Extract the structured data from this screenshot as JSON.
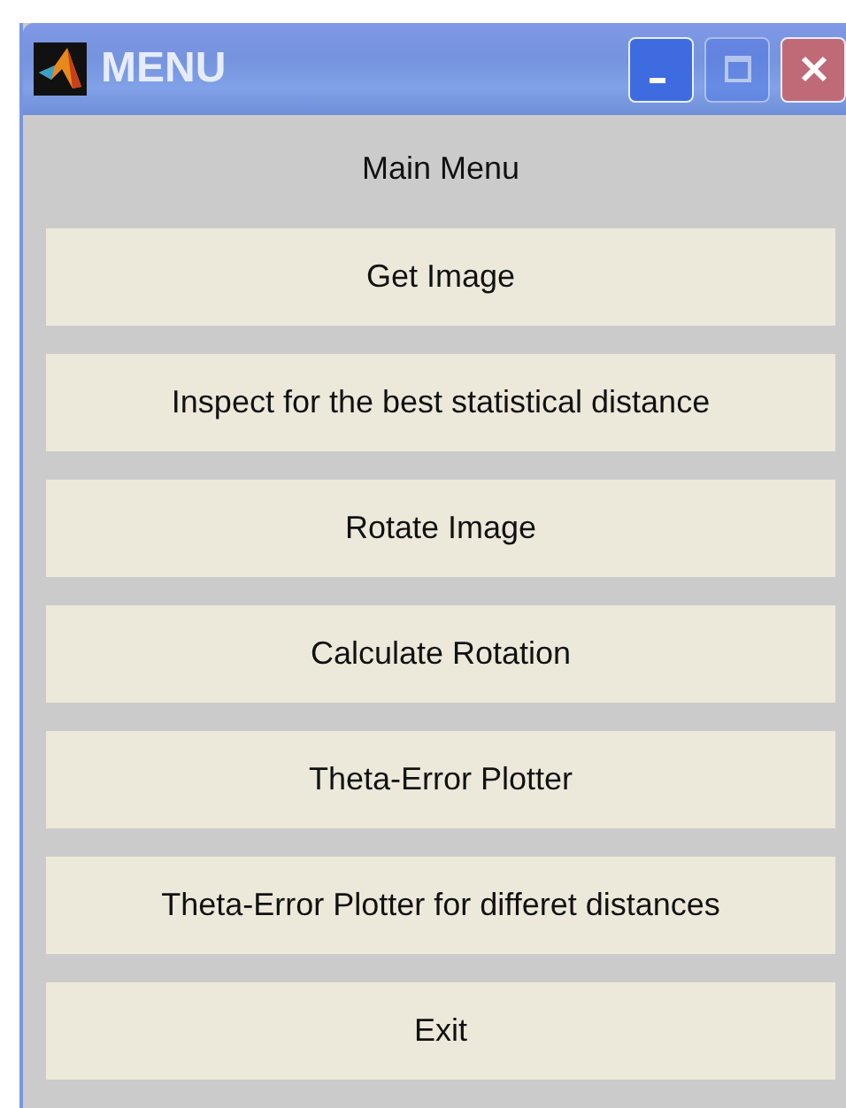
{
  "window": {
    "title": "MENU",
    "controls": [
      {
        "kind": "minimize",
        "disabled": false
      },
      {
        "kind": "maximize",
        "disabled": true
      },
      {
        "kind": "close",
        "disabled": false
      }
    ]
  },
  "heading": "Main Menu",
  "buttons": [
    "Get Image",
    "Inspect for the best statistical distance",
    "Rotate Image",
    "Calculate Rotation",
    "Theta-Error Plotter",
    "Theta-Error Plotter for differet distances",
    "Exit"
  ]
}
